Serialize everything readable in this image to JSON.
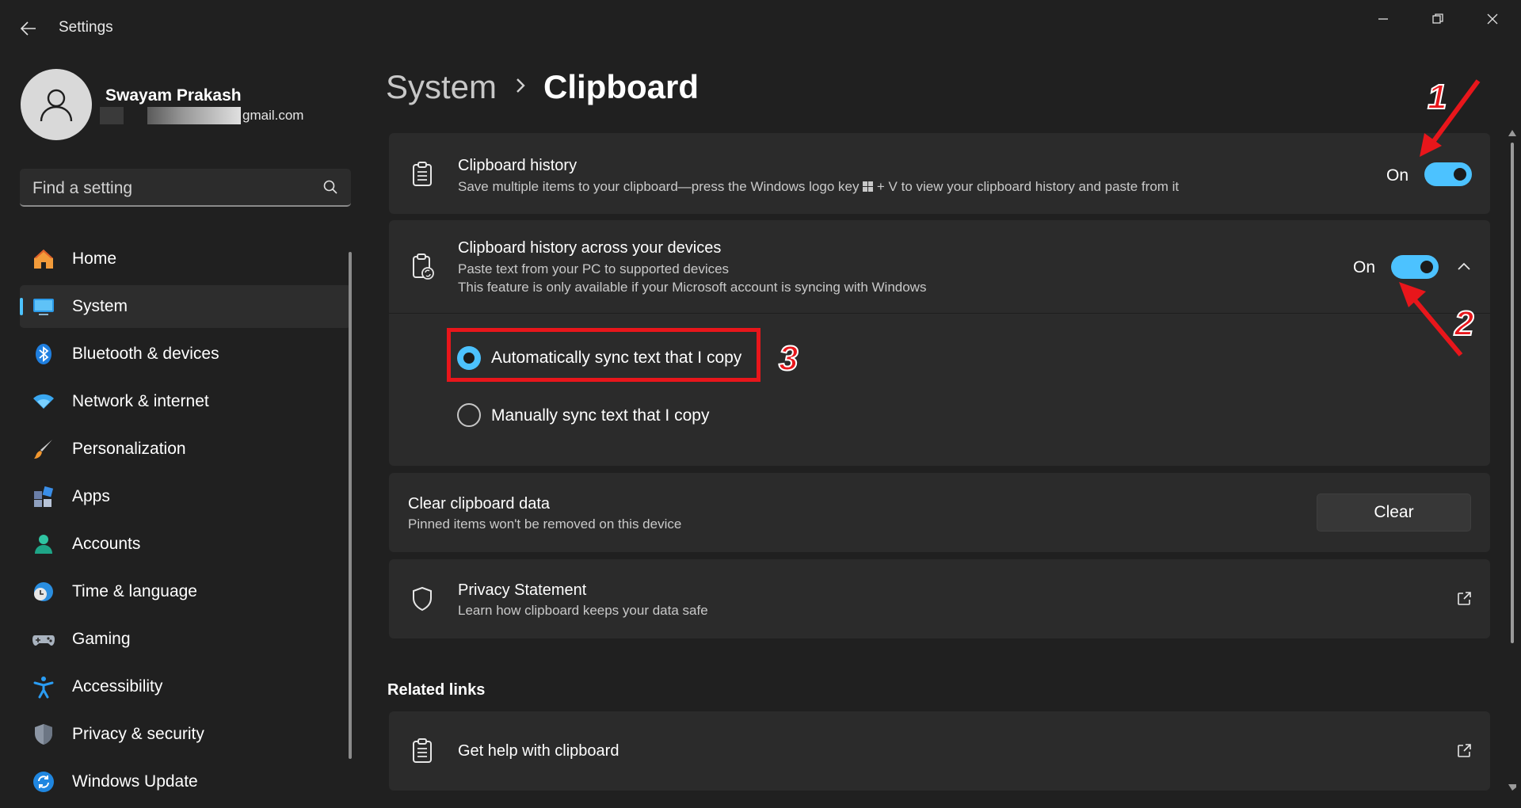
{
  "window": {
    "title": "Settings",
    "controls": [
      "minimize",
      "restore",
      "close"
    ]
  },
  "profile": {
    "name": "Swayam Prakash",
    "email_visible_suffix": "gmail.com"
  },
  "search": {
    "placeholder": "Find a setting"
  },
  "nav": {
    "items": [
      {
        "label": "Home",
        "icon": "home-icon",
        "active": false
      },
      {
        "label": "System",
        "icon": "system-monitor-icon",
        "active": true
      },
      {
        "label": "Bluetooth & devices",
        "icon": "bluetooth-icon",
        "active": false
      },
      {
        "label": "Network & internet",
        "icon": "wifi-icon",
        "active": false
      },
      {
        "label": "Personalization",
        "icon": "paintbrush-icon",
        "active": false
      },
      {
        "label": "Apps",
        "icon": "apps-icon",
        "active": false
      },
      {
        "label": "Accounts",
        "icon": "account-icon",
        "active": false
      },
      {
        "label": "Time & language",
        "icon": "globe-clock-icon",
        "active": false
      },
      {
        "label": "Gaming",
        "icon": "gamepad-icon",
        "active": false
      },
      {
        "label": "Accessibility",
        "icon": "accessibility-icon",
        "active": false
      },
      {
        "label": "Privacy & security",
        "icon": "shield-icon",
        "active": false
      },
      {
        "label": "Windows Update",
        "icon": "update-icon",
        "active": false
      }
    ]
  },
  "breadcrumb": {
    "parent": "System",
    "current": "Clipboard"
  },
  "clipboard_history": {
    "title": "Clipboard history",
    "description": "Save multiple items to your clipboard—press the Windows logo key ",
    "description_end": " + V to view your clipboard history and paste from it",
    "state": "On"
  },
  "across_devices": {
    "title": "Clipboard history across your devices",
    "line1": "Paste text from your PC to supported devices",
    "line2": "This feature is only available if your Microsoft account is syncing with Windows",
    "state": "On",
    "options": [
      {
        "label": "Automatically sync text that I copy",
        "selected": true
      },
      {
        "label": "Manually sync text that I copy",
        "selected": false
      }
    ]
  },
  "clear_data": {
    "title": "Clear clipboard data",
    "description": "Pinned items won't be removed on this device",
    "button": "Clear"
  },
  "privacy": {
    "title": "Privacy Statement",
    "description": "Learn how clipboard keeps your data safe"
  },
  "related": {
    "heading": "Related links",
    "items": [
      {
        "label": "Get help with clipboard"
      }
    ]
  },
  "annotations": {
    "markers": [
      "1",
      "2",
      "3"
    ],
    "color": "#e8161b"
  },
  "colors": {
    "accent": "#4cc2ff",
    "background": "#202020",
    "card": "#2b2b2b"
  }
}
